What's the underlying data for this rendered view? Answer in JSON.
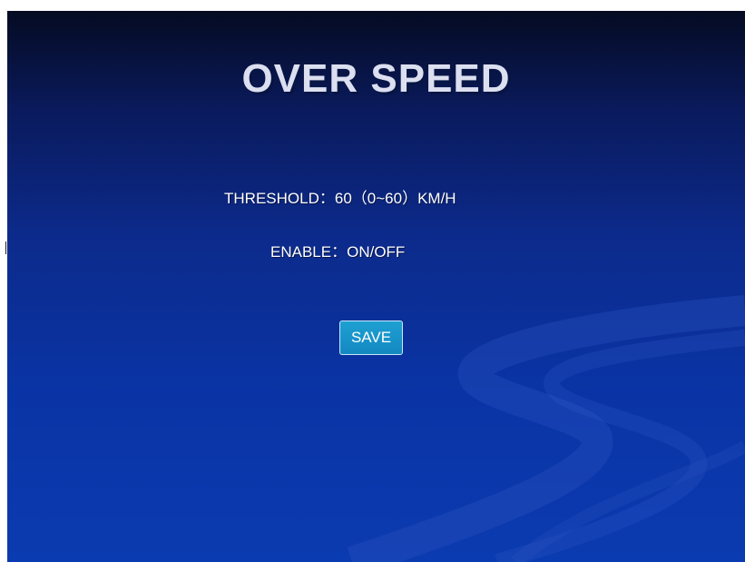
{
  "title": "OVER SPEED",
  "threshold": {
    "label": "THRESHOLD",
    "separator": "：",
    "value": "60",
    "range": "（0~60）",
    "unit": "KM/H"
  },
  "enable": {
    "label": "ENABLE",
    "separator": "：",
    "value": "ON/OFF"
  },
  "save_label": "SAVE",
  "colors": {
    "background_top": "#050b22",
    "background_bottom": "#0b3bb0",
    "button": "#1795c9",
    "title_text": "#dcdff0"
  }
}
